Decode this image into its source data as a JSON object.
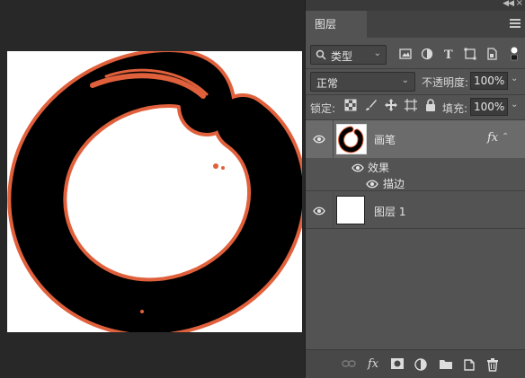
{
  "panel": {
    "tab_label": "图层",
    "filter": {
      "selected": "类型"
    },
    "blend_mode": "正常",
    "opacity": {
      "label": "不透明度:",
      "value": "100%"
    },
    "lock": {
      "label": "锁定:"
    },
    "fill": {
      "label": "填充:",
      "value": "100%"
    },
    "layers": [
      {
        "name": "画笔",
        "fx_label": "fx",
        "effects_label": "效果",
        "effect_items": [
          "描边"
        ]
      },
      {
        "name": "图层 1"
      }
    ]
  },
  "canvas": {
    "stroke_color": "#e0603c",
    "ink_color": "#000000"
  }
}
